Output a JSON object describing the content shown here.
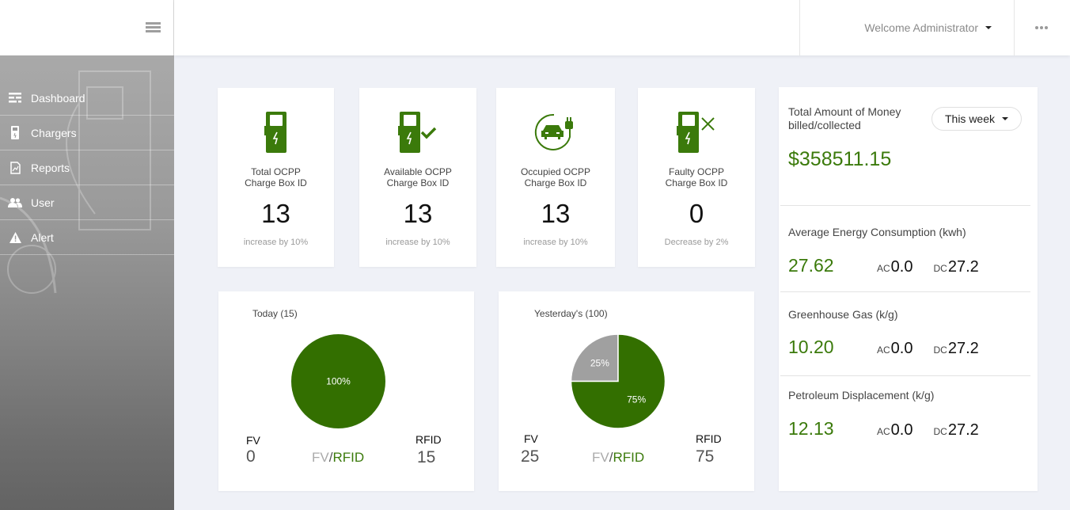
{
  "header": {
    "welcome": "Welcome Administrator",
    "menu_icon": "hamburger-icon",
    "more_icon": "ellipsis-icon"
  },
  "sidebar": {
    "items": [
      {
        "label": "Dashboard",
        "icon": "dashboard-icon"
      },
      {
        "label": "Chargers",
        "icon": "charger-icon"
      },
      {
        "label": "Reports",
        "icon": "report-icon"
      },
      {
        "label": "User",
        "icon": "users-icon"
      },
      {
        "label": "Alert",
        "icon": "warning-icon"
      }
    ]
  },
  "stats": [
    {
      "label1": "Total OCPP",
      "label2": "Charge Box ID",
      "value": "13",
      "trend": "increase by 10%",
      "icon": "charger-icon"
    },
    {
      "label1": "Available OCPP",
      "label2": "Charge Box ID",
      "value": "13",
      "trend": "increase by 10%",
      "icon": "charger-check-icon"
    },
    {
      "label1": "Occupied OCPP",
      "label2": "Charge Box ID",
      "value": "13",
      "trend": "increase by 10%",
      "icon": "car-plug-icon"
    },
    {
      "label1": "Faulty OCPP",
      "label2": "Charge Box ID",
      "value": "0",
      "trend": "Decrease by 2%",
      "icon": "charger-x-icon"
    }
  ],
  "colors": {
    "accent": "#3b7a0b",
    "pie_green": "#336f00",
    "pie_gray": "#a0a0a0"
  },
  "pies": [
    {
      "title": "Today  (15)",
      "fv_label": "FV",
      "fv_value": "0",
      "rfid_label": "RFID",
      "rfid_value": "15",
      "legend_fv": "FV",
      "legend_sep": "/",
      "legend_rfid": "RFID",
      "slices": [
        {
          "name": "FV",
          "value": 0,
          "label": ""
        },
        {
          "name": "RFID",
          "value": 100,
          "label": "100%"
        }
      ]
    },
    {
      "title": "Yesterday's (100)",
      "fv_label": "FV",
      "fv_value": "25",
      "rfid_label": "RFID",
      "rfid_value": "75",
      "legend_fv": "FV",
      "legend_sep": "/",
      "legend_rfid": "RFID",
      "slices": [
        {
          "name": "FV",
          "value": 25,
          "label": "25%"
        },
        {
          "name": "RFID",
          "value": 75,
          "label": "75%"
        }
      ]
    }
  ],
  "chart_data": [
    {
      "type": "pie",
      "title": "Today (15)",
      "categories": [
        "FV",
        "RFID"
      ],
      "values": [
        0,
        100
      ],
      "labels": [
        "",
        "100%"
      ],
      "legend": "FV/RFID"
    },
    {
      "type": "pie",
      "title": "Yesterday's (100)",
      "categories": [
        "FV",
        "RFID"
      ],
      "values": [
        25,
        75
      ],
      "labels": [
        "25%",
        "75%"
      ],
      "legend": "FV/RFID"
    }
  ],
  "right": {
    "money_title_1": "Total Amount of Money",
    "money_title_2": "billed/collected",
    "range": "This week",
    "money": "$358511.15",
    "metrics": [
      {
        "title": "Average Energy Consumption (kwh)",
        "value": "27.62",
        "ac_label": "AC",
        "ac": "0.0",
        "dc_label": "DC",
        "dc": "27.2"
      },
      {
        "title": "Greenhouse Gas (k/g)",
        "value": "10.20",
        "ac_label": "AC",
        "ac": "0.0",
        "dc_label": "DC",
        "dc": "27.2"
      },
      {
        "title": "Petroleum Displacement (k/g)",
        "value": "12.13",
        "ac_label": "AC",
        "ac": "0.0",
        "dc_label": "DC",
        "dc": "27.2"
      }
    ]
  }
}
